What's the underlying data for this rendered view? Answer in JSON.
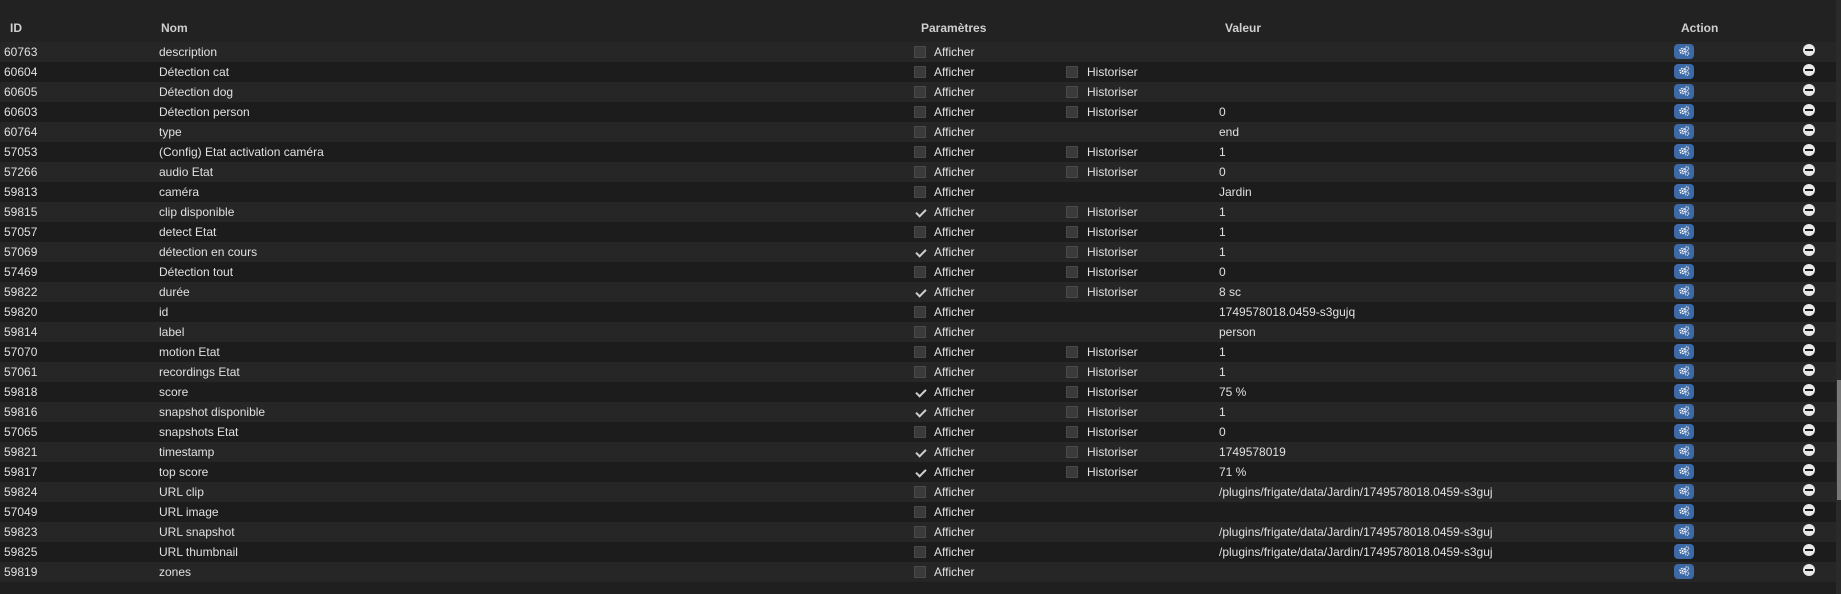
{
  "header": {
    "id": "ID",
    "name": "Nom",
    "params": "Paramètres",
    "value": "Valeur",
    "action": "Action"
  },
  "labels": {
    "show": "Afficher",
    "hist": "Historiser"
  },
  "icons": {
    "config": "gears-icon",
    "remove": "minus-circle-icon"
  },
  "colors": {
    "config_button": "#3d6aa7"
  },
  "rows": [
    {
      "id": "60763",
      "name": "description",
      "show": false,
      "hasHist": false,
      "hist": false,
      "value": ""
    },
    {
      "id": "60604",
      "name": "Détection cat",
      "show": false,
      "hasHist": true,
      "hist": false,
      "value": ""
    },
    {
      "id": "60605",
      "name": "Détection dog",
      "show": false,
      "hasHist": true,
      "hist": false,
      "value": ""
    },
    {
      "id": "60603",
      "name": "Détection person",
      "show": false,
      "hasHist": true,
      "hist": false,
      "value": "0"
    },
    {
      "id": "60764",
      "name": "type",
      "show": false,
      "hasHist": false,
      "hist": false,
      "value": "end"
    },
    {
      "id": "57053",
      "name": "(Config) Etat activation caméra",
      "show": false,
      "hasHist": true,
      "hist": false,
      "value": "1"
    },
    {
      "id": "57266",
      "name": "audio Etat",
      "show": false,
      "hasHist": true,
      "hist": false,
      "value": "0"
    },
    {
      "id": "59813",
      "name": "caméra",
      "show": false,
      "hasHist": false,
      "hist": false,
      "value": "Jardin"
    },
    {
      "id": "59815",
      "name": "clip disponible",
      "show": true,
      "hasHist": true,
      "hist": false,
      "value": "1"
    },
    {
      "id": "57057",
      "name": "detect Etat",
      "show": false,
      "hasHist": true,
      "hist": false,
      "value": "1"
    },
    {
      "id": "57069",
      "name": "détection en cours",
      "show": true,
      "hasHist": true,
      "hist": false,
      "value": "1"
    },
    {
      "id": "57469",
      "name": "Détection tout",
      "show": false,
      "hasHist": true,
      "hist": false,
      "value": "0"
    },
    {
      "id": "59822",
      "name": "durée",
      "show": true,
      "hasHist": true,
      "hist": false,
      "value": "8 sc"
    },
    {
      "id": "59820",
      "name": "id",
      "show": false,
      "hasHist": false,
      "hist": false,
      "value": "1749578018.0459-s3gujq"
    },
    {
      "id": "59814",
      "name": "label",
      "show": false,
      "hasHist": false,
      "hist": false,
      "value": "person"
    },
    {
      "id": "57070",
      "name": "motion Etat",
      "show": false,
      "hasHist": true,
      "hist": false,
      "value": "1"
    },
    {
      "id": "57061",
      "name": "recordings Etat",
      "show": false,
      "hasHist": true,
      "hist": false,
      "value": "1"
    },
    {
      "id": "59818",
      "name": "score",
      "show": true,
      "hasHist": true,
      "hist": false,
      "value": "75 %"
    },
    {
      "id": "59816",
      "name": "snapshot disponible",
      "show": true,
      "hasHist": true,
      "hist": false,
      "value": "1"
    },
    {
      "id": "57065",
      "name": "snapshots Etat",
      "show": false,
      "hasHist": true,
      "hist": false,
      "value": "0"
    },
    {
      "id": "59821",
      "name": "timestamp",
      "show": true,
      "hasHist": true,
      "hist": false,
      "value": "1749578019"
    },
    {
      "id": "59817",
      "name": "top score",
      "show": true,
      "hasHist": true,
      "hist": false,
      "value": "71 %"
    },
    {
      "id": "59824",
      "name": "URL clip",
      "show": false,
      "hasHist": false,
      "hist": false,
      "value": "/plugins/frigate/data/Jardin/1749578018.0459-s3guj"
    },
    {
      "id": "57049",
      "name": "URL image",
      "show": false,
      "hasHist": false,
      "hist": false,
      "value": ""
    },
    {
      "id": "59823",
      "name": "URL snapshot",
      "show": false,
      "hasHist": false,
      "hist": false,
      "value": "/plugins/frigate/data/Jardin/1749578018.0459-s3guj"
    },
    {
      "id": "59825",
      "name": "URL thumbnail",
      "show": false,
      "hasHist": false,
      "hist": false,
      "value": "/plugins/frigate/data/Jardin/1749578018.0459-s3guj"
    },
    {
      "id": "59819",
      "name": "zones",
      "show": false,
      "hasHist": false,
      "hist": false,
      "value": ""
    }
  ]
}
